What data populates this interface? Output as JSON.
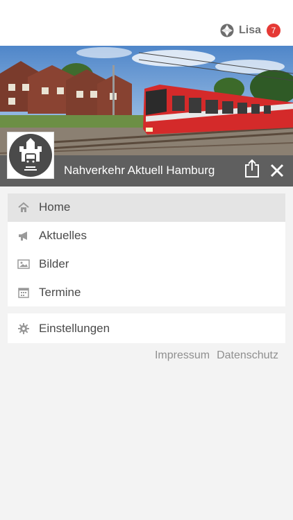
{
  "user": {
    "name": "Lisa",
    "notification_count": "7",
    "logo_icon": "app-logo-icon"
  },
  "header": {
    "title": "Nahverkehr Aktuell Hamburg",
    "share_icon": "share-icon",
    "close_icon": "close-icon",
    "avatar_icon": "hamburg-train-logo-icon"
  },
  "menu": {
    "items": [
      {
        "label": "Home",
        "icon": "home-icon",
        "active": true
      },
      {
        "label": "Aktuelles",
        "icon": "megaphone-icon",
        "active": false
      },
      {
        "label": "Bilder",
        "icon": "image-icon",
        "active": false
      },
      {
        "label": "Termine",
        "icon": "calendar-icon",
        "active": false
      }
    ],
    "settings": {
      "label": "Einstellungen",
      "icon": "gear-icon"
    }
  },
  "footer": {
    "impressum": "Impressum",
    "datenschutz": "Datenschutz"
  },
  "colors": {
    "badge": "#e53935",
    "title_bar": "#5f5f5f",
    "active_item": "#e4e4e4",
    "train_red": "#d42a2a"
  }
}
